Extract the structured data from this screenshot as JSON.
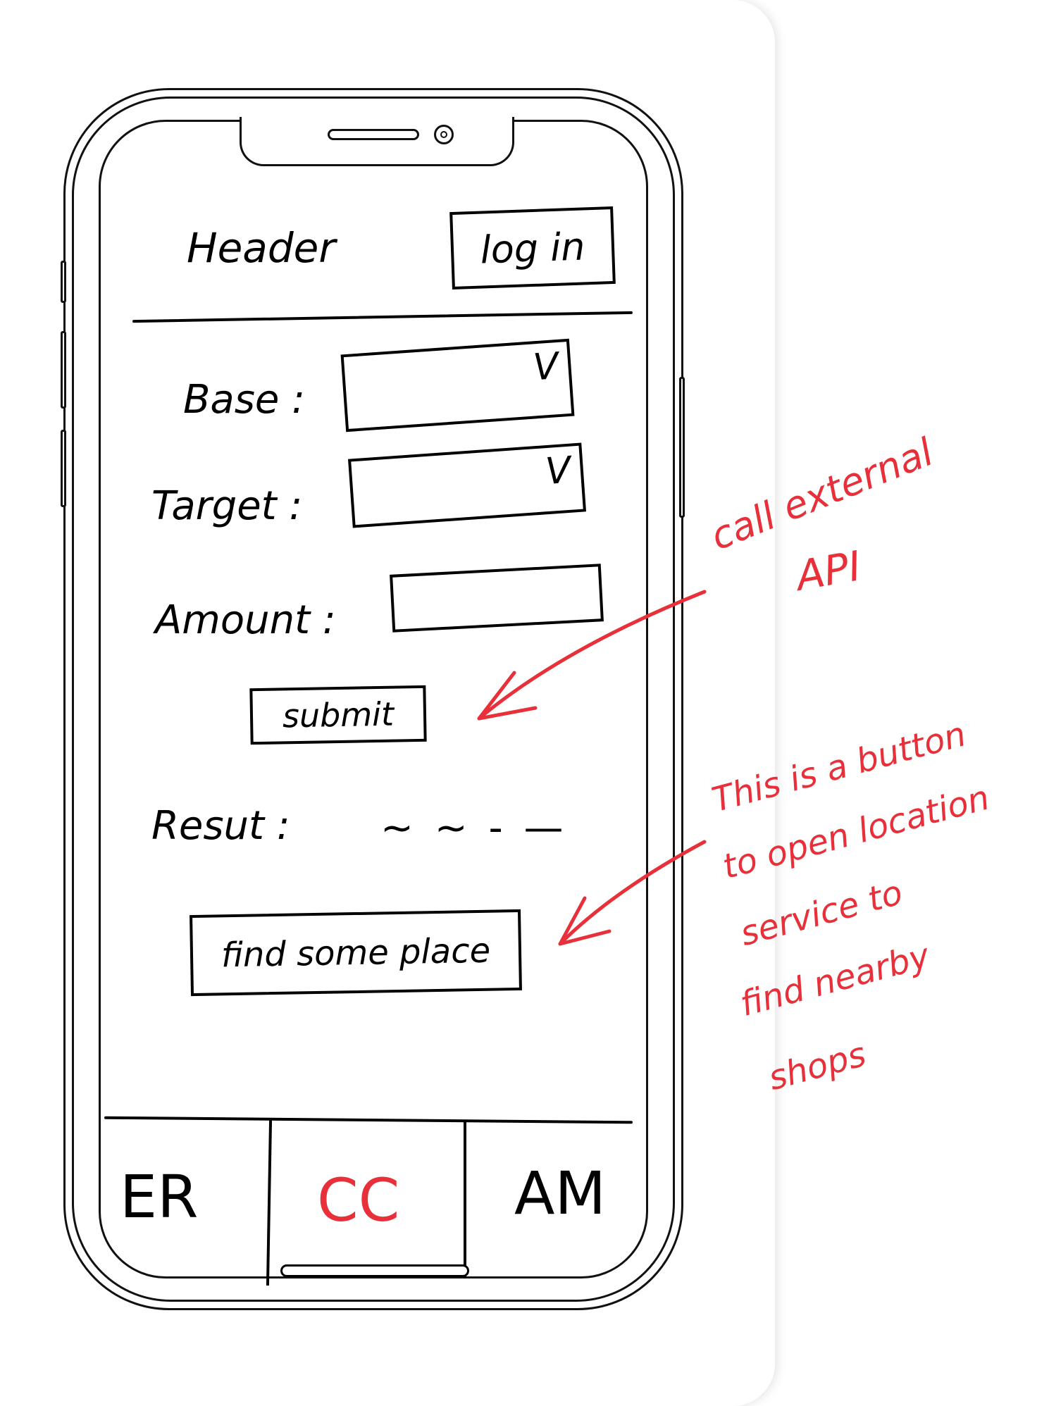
{
  "header": {
    "title": "Header",
    "login_label": "log in"
  },
  "form": {
    "base_label": "Base :",
    "target_label": "Target :",
    "amount_label": "Amount :",
    "dropdown_marker": "V",
    "submit_label": "submit",
    "result_label": "Resut :",
    "result_value": "~ ~ - —",
    "find_label": "find some place"
  },
  "tabs": [
    {
      "label": "ER",
      "active": false
    },
    {
      "label": "CC",
      "active": true
    },
    {
      "label": "AM",
      "active": false
    }
  ],
  "annotations": {
    "note1_line1": "call external",
    "note1_line2": "API",
    "note2_line1": "This is a button",
    "note2_line2": "to open location",
    "note2_line3": "service to",
    "note2_line4": "find nearby",
    "note2_line5": "shops"
  },
  "colors": {
    "ink": "#000000",
    "annotation": "#e8303a",
    "background": "#ffffff"
  }
}
